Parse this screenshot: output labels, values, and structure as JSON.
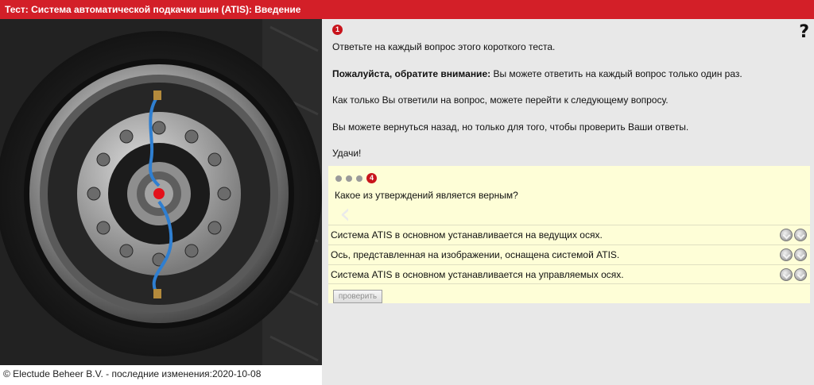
{
  "window": {
    "title": "Тест: Система автоматической подкачки шин (ATIS): Введение"
  },
  "intro": {
    "step_badge": "1",
    "line1": "Ответьте на каждый вопрос этого короткого теста.",
    "notice_bold": "Пожалуйста, обратите внимание:",
    "notice_rest": " Вы можете ответить на каждый вопрос только один раз.",
    "line3": "Как только Вы ответили на вопрос, можете перейти к следующему вопросу.",
    "line4": "Вы можете вернуться назад, но только для того, чтобы проверить Ваши ответы.",
    "line5": "Удачи!"
  },
  "help": {
    "label": "?"
  },
  "question": {
    "step_badge": "4",
    "text": "Какое из утверждений является верным?",
    "answers": [
      {
        "text": "Система ATIS в основном устанавливается на ведущих осях."
      },
      {
        "text": "Ось, представленная на изображении, оснащена системой ATIS."
      },
      {
        "text": "Система ATIS в основном устанавливается на управляемых осях."
      }
    ],
    "check_button": "проверить"
  },
  "footer": {
    "text": "© Electude Beheer B.V. - последние изменения:2020-10-08"
  },
  "colors": {
    "accent": "#d31f28",
    "question_panel": "#fefed7",
    "hose": "#2f7fd1"
  },
  "icons": {
    "help": "question-mark-icon",
    "choice": "radio-check-icon",
    "back": "chevron-left-icon"
  }
}
